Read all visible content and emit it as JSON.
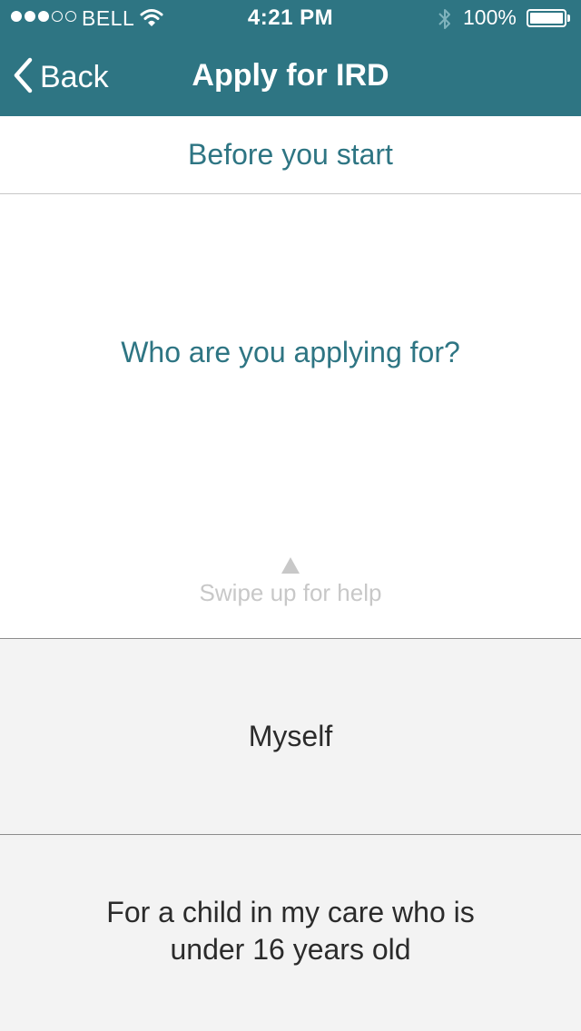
{
  "status_bar": {
    "carrier": "BELL",
    "time": "4:21 PM",
    "battery": "100%",
    "battery_level": 1.0,
    "signal_bars_filled": 3,
    "signal_bars_total": 5
  },
  "nav": {
    "back_label": "Back",
    "title": "Apply for IRD"
  },
  "section": {
    "header": "Before you start"
  },
  "main": {
    "question": "Who are you applying for?",
    "swipe_hint": "Swipe up for help"
  },
  "options": [
    {
      "label": "Myself"
    },
    {
      "label": "For a child in my care who is under 16 years old"
    }
  ],
  "colors": {
    "accent": "#2e7583",
    "hint": "#c8c8c8",
    "option_bg": "#f3f3f3",
    "option_text": "#2b2b2b"
  }
}
